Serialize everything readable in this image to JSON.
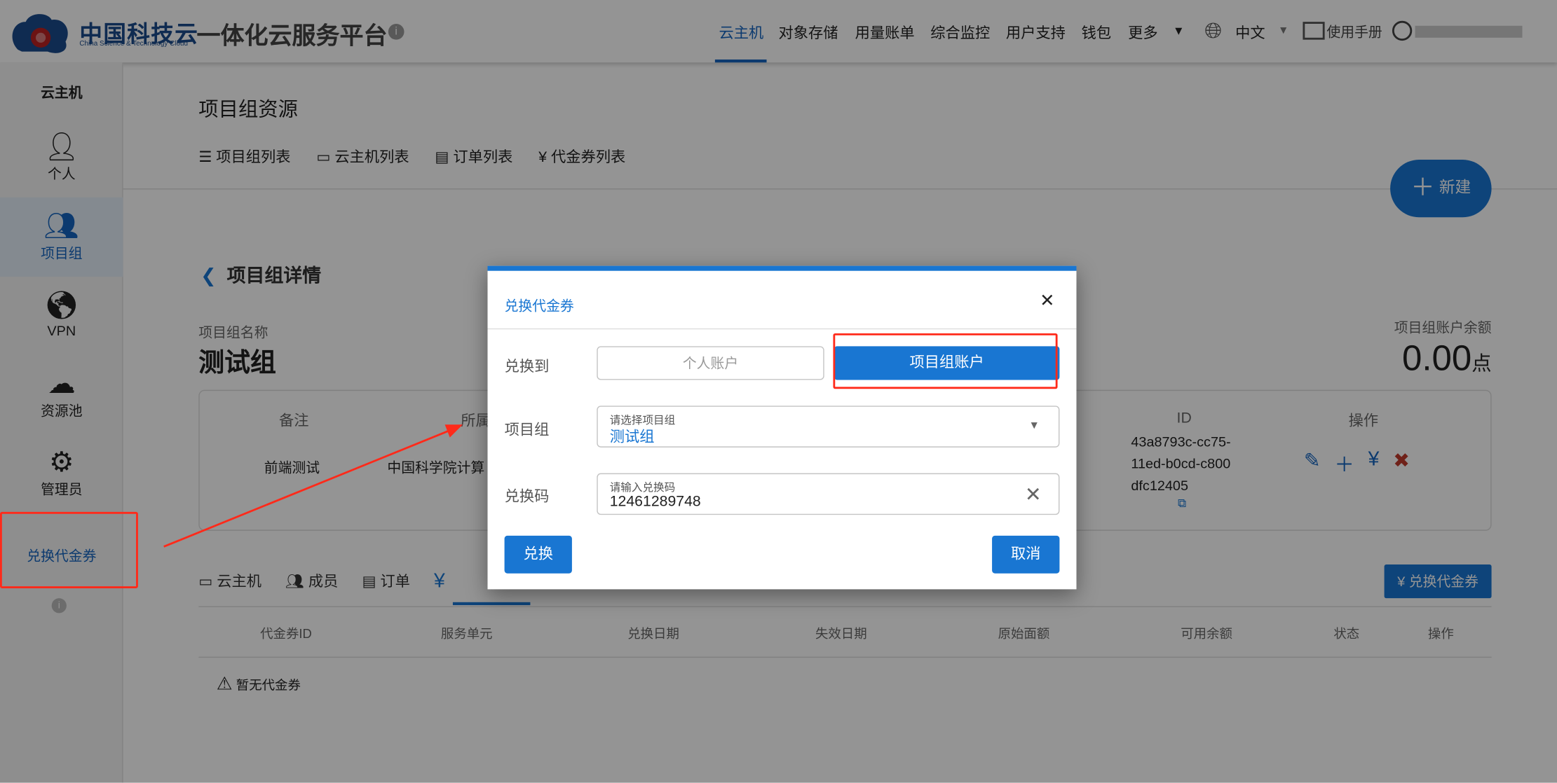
{
  "header": {
    "logo_cn": "中国科技云",
    "logo_en": "China Science & Technology Cloud",
    "title": "一体化云服务平台",
    "nav": [
      "云主机",
      "对象存储",
      "用量账单",
      "综合监控",
      "用户支持",
      "钱包",
      "更多"
    ],
    "language": "中文",
    "manual": "使用手册"
  },
  "sidebar": {
    "title": "云主机",
    "items": [
      {
        "label": "个人",
        "icon": "person-icon"
      },
      {
        "label": "项目组",
        "icon": "group-icon"
      },
      {
        "label": "VPN",
        "icon": "vpn-icon"
      },
      {
        "label": "资源池",
        "icon": "cloud-upload-icon"
      },
      {
        "label": "管理员",
        "icon": "admin-icon"
      }
    ],
    "redeem": "兑换代金券"
  },
  "page": {
    "title": "项目组资源",
    "tabs": [
      "项目组列表",
      "云主机列表",
      "订单列表",
      "代金券列表"
    ],
    "new_button": "新建",
    "detail_title": "项目组详情",
    "name_label": "项目组名称",
    "name": "测试组",
    "balance_label": "项目组账户余额",
    "balance": "0.00",
    "balance_unit": "点",
    "info_headers": {
      "remark": "备注",
      "owner": "所属",
      "id": "ID",
      "ops": "操作"
    },
    "info_values": {
      "remark": "前端测试",
      "owner": "中国科学院计算",
      "id": "43a8793c-cc75-11ed-b0cd-c800dfc12405"
    },
    "sub_tabs": [
      "云主机",
      "成员",
      "订单",
      ""
    ],
    "redeem_button": "兑换代金券",
    "table_headers": [
      "代金券ID",
      "服务单元",
      "兑换日期",
      "失效日期",
      "原始面额",
      "可用余额",
      "状态",
      "操作"
    ],
    "empty": "暂无代金券"
  },
  "dialog": {
    "title": "兑换代金券",
    "to_label": "兑换到",
    "personal": "个人账户",
    "group": "项目组账户",
    "group_label": "项目组",
    "group_placeholder": "请选择项目组",
    "group_value": "测试组",
    "code_label": "兑换码",
    "code_placeholder": "请输入兑换码",
    "code_value": "12461289748",
    "submit": "兑换",
    "cancel": "取消"
  },
  "colors": {
    "primary": "#1976d2",
    "annotation": "#ff2a1a"
  }
}
